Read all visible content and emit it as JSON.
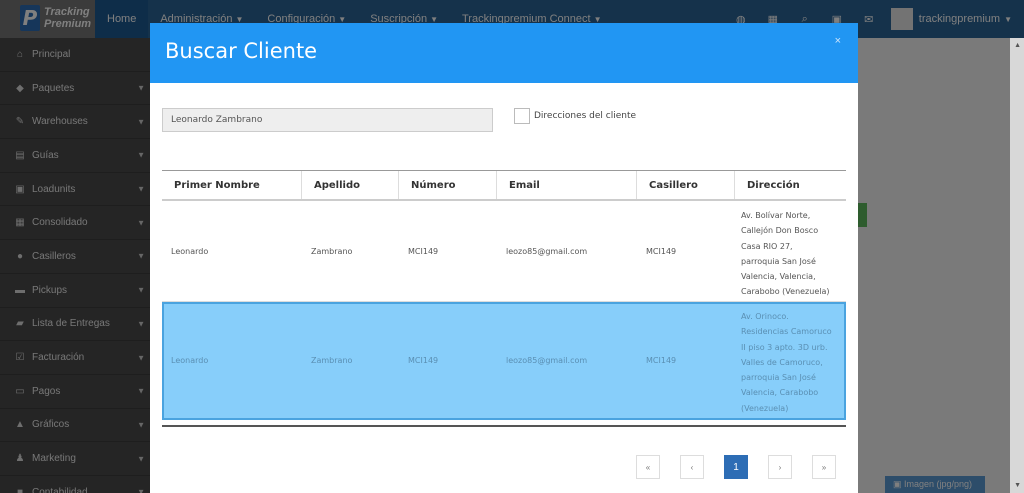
{
  "navbar": {
    "brand_line1": "Tracking",
    "brand_line2": "Premium",
    "links": [
      {
        "label": "Home",
        "caret": false
      },
      {
        "label": "Administración",
        "caret": true
      },
      {
        "label": "Configuración",
        "caret": true
      },
      {
        "label": "Suscripción",
        "caret": true
      },
      {
        "label": "Trackingpremium Connect",
        "caret": true
      }
    ],
    "icons": [
      "globe-icon",
      "grid-icon",
      "search-icon",
      "card-icon",
      "envelope-icon"
    ],
    "user": "trackingpremium"
  },
  "sidebar": {
    "items": [
      {
        "label": "Principal",
        "icon": "home-icon",
        "glyph": "⌂",
        "arrow": false
      },
      {
        "label": "Paquetes",
        "icon": "tag-icon",
        "glyph": "◆",
        "arrow": true
      },
      {
        "label": "Warehouses",
        "icon": "edit-icon",
        "glyph": "✎",
        "arrow": true
      },
      {
        "label": "Guías",
        "icon": "list-icon",
        "glyph": "▤",
        "arrow": true
      },
      {
        "label": "Loadunits",
        "icon": "box-icon",
        "glyph": "▣",
        "arrow": true
      },
      {
        "label": "Consolidado",
        "icon": "table-icon",
        "glyph": "▦",
        "arrow": true
      },
      {
        "label": "Casilleros",
        "icon": "map-marker-icon",
        "glyph": "●",
        "arrow": true
      },
      {
        "label": "Pickups",
        "icon": "car-icon",
        "glyph": "▬",
        "arrow": true
      },
      {
        "label": "Lista de Entregas",
        "icon": "truck-icon",
        "glyph": "▰",
        "arrow": true
      },
      {
        "label": "Facturación",
        "icon": "check-square-icon",
        "glyph": "☑",
        "arrow": true
      },
      {
        "label": "Pagos",
        "icon": "money-icon",
        "glyph": "▭",
        "arrow": true
      },
      {
        "label": "Gráficos",
        "icon": "area-chart-icon",
        "glyph": "▲",
        "arrow": true
      },
      {
        "label": "Marketing",
        "icon": "users-icon",
        "glyph": "♟",
        "arrow": true
      },
      {
        "label": "Contabilidad",
        "icon": "book-icon",
        "glyph": "■",
        "arrow": true
      }
    ]
  },
  "background": {
    "button_label": "Imagen (jpg/png)"
  },
  "modal": {
    "title": "Buscar Cliente",
    "close": "×",
    "search_value": "Leonardo Zambrano",
    "checkbox_label": "Direcciones del cliente",
    "columns": [
      "Primer Nombre",
      "Apellido",
      "Número",
      "Email",
      "Casillero",
      "Dirección"
    ],
    "rows": [
      {
        "nombre": "Leonardo",
        "apellido": "Zambrano",
        "numero": "MCI149",
        "email": "leozo85@gmail.com",
        "casillero": "MCI149",
        "direccion": [
          "Av. Bolívar Norte,",
          "Callejón Don Bosco",
          "Casa RIO 27,",
          "parroquia San José",
          "Valencia, Valencia,",
          "Carabobo (Venezuela)"
        ],
        "selected": false
      },
      {
        "nombre": "Leonardo",
        "apellido": "Zambrano",
        "numero": "MCI149",
        "email": "leozo85@gmail.com",
        "casillero": "MCI149",
        "direccion": [
          "Av. Orinoco.",
          "Residencias Camoruco",
          "II piso 3 apto. 3D urb.",
          "Valles de Camoruco,",
          "parroquia San José",
          "Valencia, Carabobo",
          "(Venezuela)"
        ],
        "selected": true
      }
    ],
    "pager": [
      "«",
      "‹",
      "1",
      "›",
      "»"
    ],
    "active_page": "1"
  },
  "colors": {
    "navbar": "#2a6496",
    "modal_header": "#2196f3",
    "selected_row": "#87cefa",
    "sidebar": "#4a4a4a"
  }
}
